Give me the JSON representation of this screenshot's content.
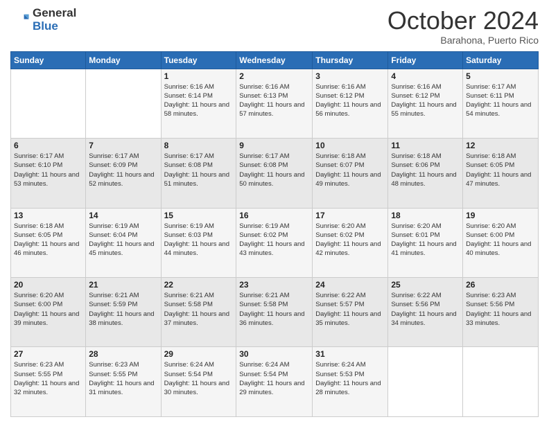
{
  "logo": {
    "line1": "General",
    "line2": "Blue"
  },
  "header": {
    "month": "October 2024",
    "location": "Barahona, Puerto Rico"
  },
  "weekdays": [
    "Sunday",
    "Monday",
    "Tuesday",
    "Wednesday",
    "Thursday",
    "Friday",
    "Saturday"
  ],
  "weeks": [
    [
      {
        "day": "",
        "info": ""
      },
      {
        "day": "",
        "info": ""
      },
      {
        "day": "1",
        "sunrise": "6:16 AM",
        "sunset": "6:14 PM",
        "daylight": "11 hours and 58 minutes."
      },
      {
        "day": "2",
        "sunrise": "6:16 AM",
        "sunset": "6:13 PM",
        "daylight": "11 hours and 57 minutes."
      },
      {
        "day": "3",
        "sunrise": "6:16 AM",
        "sunset": "6:12 PM",
        "daylight": "11 hours and 56 minutes."
      },
      {
        "day": "4",
        "sunrise": "6:16 AM",
        "sunset": "6:12 PM",
        "daylight": "11 hours and 55 minutes."
      },
      {
        "day": "5",
        "sunrise": "6:17 AM",
        "sunset": "6:11 PM",
        "daylight": "11 hours and 54 minutes."
      }
    ],
    [
      {
        "day": "6",
        "sunrise": "6:17 AM",
        "sunset": "6:10 PM",
        "daylight": "11 hours and 53 minutes."
      },
      {
        "day": "7",
        "sunrise": "6:17 AM",
        "sunset": "6:09 PM",
        "daylight": "11 hours and 52 minutes."
      },
      {
        "day": "8",
        "sunrise": "6:17 AM",
        "sunset": "6:08 PM",
        "daylight": "11 hours and 51 minutes."
      },
      {
        "day": "9",
        "sunrise": "6:17 AM",
        "sunset": "6:08 PM",
        "daylight": "11 hours and 50 minutes."
      },
      {
        "day": "10",
        "sunrise": "6:18 AM",
        "sunset": "6:07 PM",
        "daylight": "11 hours and 49 minutes."
      },
      {
        "day": "11",
        "sunrise": "6:18 AM",
        "sunset": "6:06 PM",
        "daylight": "11 hours and 48 minutes."
      },
      {
        "day": "12",
        "sunrise": "6:18 AM",
        "sunset": "6:05 PM",
        "daylight": "11 hours and 47 minutes."
      }
    ],
    [
      {
        "day": "13",
        "sunrise": "6:18 AM",
        "sunset": "6:05 PM",
        "daylight": "11 hours and 46 minutes."
      },
      {
        "day": "14",
        "sunrise": "6:19 AM",
        "sunset": "6:04 PM",
        "daylight": "11 hours and 45 minutes."
      },
      {
        "day": "15",
        "sunrise": "6:19 AM",
        "sunset": "6:03 PM",
        "daylight": "11 hours and 44 minutes."
      },
      {
        "day": "16",
        "sunrise": "6:19 AM",
        "sunset": "6:02 PM",
        "daylight": "11 hours and 43 minutes."
      },
      {
        "day": "17",
        "sunrise": "6:20 AM",
        "sunset": "6:02 PM",
        "daylight": "11 hours and 42 minutes."
      },
      {
        "day": "18",
        "sunrise": "6:20 AM",
        "sunset": "6:01 PM",
        "daylight": "11 hours and 41 minutes."
      },
      {
        "day": "19",
        "sunrise": "6:20 AM",
        "sunset": "6:00 PM",
        "daylight": "11 hours and 40 minutes."
      }
    ],
    [
      {
        "day": "20",
        "sunrise": "6:20 AM",
        "sunset": "6:00 PM",
        "daylight": "11 hours and 39 minutes."
      },
      {
        "day": "21",
        "sunrise": "6:21 AM",
        "sunset": "5:59 PM",
        "daylight": "11 hours and 38 minutes."
      },
      {
        "day": "22",
        "sunrise": "6:21 AM",
        "sunset": "5:58 PM",
        "daylight": "11 hours and 37 minutes."
      },
      {
        "day": "23",
        "sunrise": "6:21 AM",
        "sunset": "5:58 PM",
        "daylight": "11 hours and 36 minutes."
      },
      {
        "day": "24",
        "sunrise": "6:22 AM",
        "sunset": "5:57 PM",
        "daylight": "11 hours and 35 minutes."
      },
      {
        "day": "25",
        "sunrise": "6:22 AM",
        "sunset": "5:56 PM",
        "daylight": "11 hours and 34 minutes."
      },
      {
        "day": "26",
        "sunrise": "6:23 AM",
        "sunset": "5:56 PM",
        "daylight": "11 hours and 33 minutes."
      }
    ],
    [
      {
        "day": "27",
        "sunrise": "6:23 AM",
        "sunset": "5:55 PM",
        "daylight": "11 hours and 32 minutes."
      },
      {
        "day": "28",
        "sunrise": "6:23 AM",
        "sunset": "5:55 PM",
        "daylight": "11 hours and 31 minutes."
      },
      {
        "day": "29",
        "sunrise": "6:24 AM",
        "sunset": "5:54 PM",
        "daylight": "11 hours and 30 minutes."
      },
      {
        "day": "30",
        "sunrise": "6:24 AM",
        "sunset": "5:54 PM",
        "daylight": "11 hours and 29 minutes."
      },
      {
        "day": "31",
        "sunrise": "6:24 AM",
        "sunset": "5:53 PM",
        "daylight": "11 hours and 28 minutes."
      },
      {
        "day": "",
        "info": ""
      },
      {
        "day": "",
        "info": ""
      }
    ]
  ],
  "labels": {
    "sunrise_prefix": "Sunrise: ",
    "sunset_prefix": "Sunset: ",
    "daylight_prefix": "Daylight: "
  }
}
